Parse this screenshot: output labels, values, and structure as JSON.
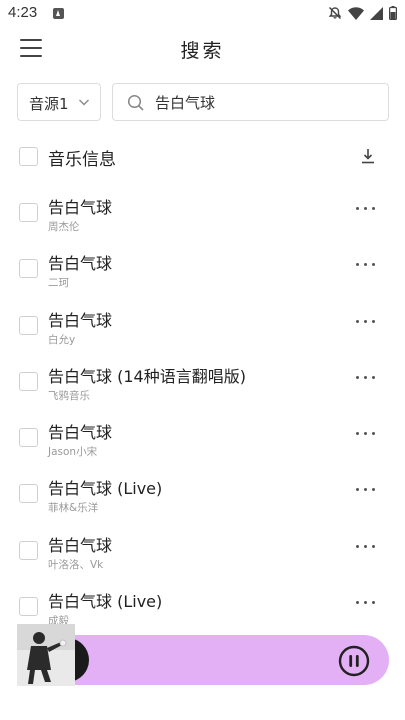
{
  "status_bar": {
    "time": "4:23",
    "icons": [
      "app-notification-icon",
      "mute-icon",
      "wifi-icon",
      "signal-icon",
      "battery-icon"
    ]
  },
  "header": {
    "title": "搜索",
    "menu_icon": "hamburger-menu-icon"
  },
  "search": {
    "source_label": "音源1",
    "value": "告白气球",
    "placeholder": ""
  },
  "list_header": {
    "title": "音乐信息",
    "download_icon": "download-icon"
  },
  "songs": [
    {
      "title": "告白气球",
      "artist": "周杰伦"
    },
    {
      "title": "告白气球",
      "artist": "二珂"
    },
    {
      "title": "告白气球",
      "artist": "白允y"
    },
    {
      "title": "告白气球 (14种语言翻唱版)",
      "artist": "飞鸦音乐"
    },
    {
      "title": "告白气球",
      "artist": "Jason小宋"
    },
    {
      "title": "告白气球 (Live)",
      "artist": "菲林&乐洋"
    },
    {
      "title": "告白气球",
      "artist": "叶洛洛、Vk"
    },
    {
      "title": "告白气球 (Live)",
      "artist": "成毅"
    }
  ],
  "player": {
    "state_icon": "pause-icon"
  },
  "colors": {
    "player_bar": "#e3b0f5",
    "text_primary": "#222222",
    "text_secondary": "#9a9a9a",
    "border": "#dddddd"
  }
}
